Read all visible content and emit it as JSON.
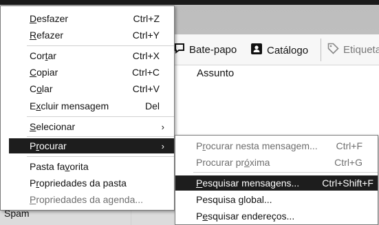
{
  "toolbar": {
    "chat_label": "Bate-papo",
    "catalog_label": "Catálogo",
    "tags_label": "Etiqueta",
    "chat_icon": "chat-bubble-icon",
    "catalog_icon": "address-book-icon",
    "tags_icon": "tag-icon"
  },
  "message_list": {
    "subject_header": "Assunto"
  },
  "folders": {
    "spam": "Spam"
  },
  "context_menu": {
    "items": [
      {
        "pre": "",
        "key": "D",
        "post": "esfazer",
        "shortcut": "Ctrl+Z",
        "disabled": false
      },
      {
        "pre": "",
        "key": "R",
        "post": "efazer",
        "shortcut": "Ctrl+Y",
        "disabled": false
      },
      {
        "pre": "Cor",
        "key": "t",
        "post": "ar",
        "shortcut": "Ctrl+X",
        "disabled": false
      },
      {
        "pre": "",
        "key": "C",
        "post": "opiar",
        "shortcut": "Ctrl+C",
        "disabled": false
      },
      {
        "pre": "C",
        "key": "o",
        "post": "lar",
        "shortcut": "Ctrl+V",
        "disabled": false
      },
      {
        "pre": "E",
        "key": "x",
        "post": "cluir mensagem",
        "shortcut": "Del",
        "disabled": false
      },
      {
        "pre": "",
        "key": "S",
        "post": "elecionar",
        "arrow": "›"
      },
      {
        "pre": "P",
        "key": "r",
        "post": "ocurar",
        "arrow": "›",
        "highlighted": true
      },
      {
        "pre": "Pasta fa",
        "key": "v",
        "post": "orita"
      },
      {
        "pre": "P",
        "key": "r",
        "post": "opriedades da pasta"
      },
      {
        "pre": "",
        "key": "P",
        "post": "ropriedades da agenda...",
        "disabled": true
      }
    ]
  },
  "submenu": {
    "items": [
      {
        "pre": "P",
        "key": "r",
        "post": "ocurar nesta mensagem...",
        "shortcut": "Ctrl+F",
        "disabled": true
      },
      {
        "pre": "Procurar pr",
        "key": "ó",
        "post": "xima",
        "shortcut": "Ctrl+G",
        "disabled": true
      },
      {
        "pre": "",
        "key": "P",
        "post": "esquisar mensagens...",
        "shortcut": "Ctrl+Shift+F",
        "highlighted": true
      },
      {
        "pre": "Pesquisa ",
        "key": "g",
        "post": "lobal...",
        "shortcut": ""
      },
      {
        "pre": "P",
        "key": "e",
        "post": "squisar endereços...",
        "shortcut": ""
      }
    ]
  }
}
